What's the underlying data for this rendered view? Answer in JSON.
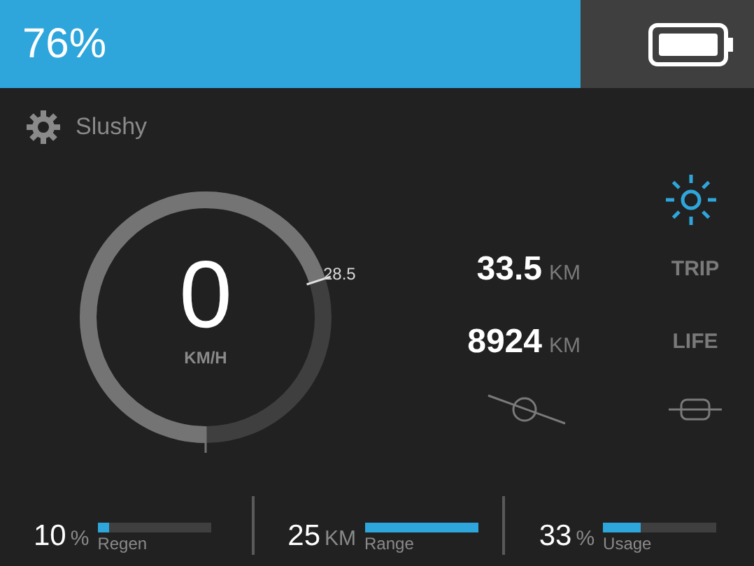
{
  "battery": {
    "reading": "76%",
    "level": 0.77
  },
  "mode": {
    "label": "Slushy"
  },
  "speedometer": {
    "speed": "0",
    "unit": "KM/H",
    "marker": "28.5",
    "level": 0.7
  },
  "light": {
    "on": true
  },
  "odometer": [
    {
      "value": "33.5",
      "unit": "KM",
      "label": "TRIP"
    },
    {
      "value": "8924",
      "unit": "KM",
      "label": "LIFE"
    }
  ],
  "stats": [
    {
      "value": "10",
      "unit": "%",
      "label": "Regen",
      "level": 0.1
    },
    {
      "value": "25",
      "unit": "KM",
      "label": "Range",
      "level": 1.0
    },
    {
      "value": "33",
      "unit": "%",
      "label": "Usage",
      "level": 0.33
    }
  ]
}
